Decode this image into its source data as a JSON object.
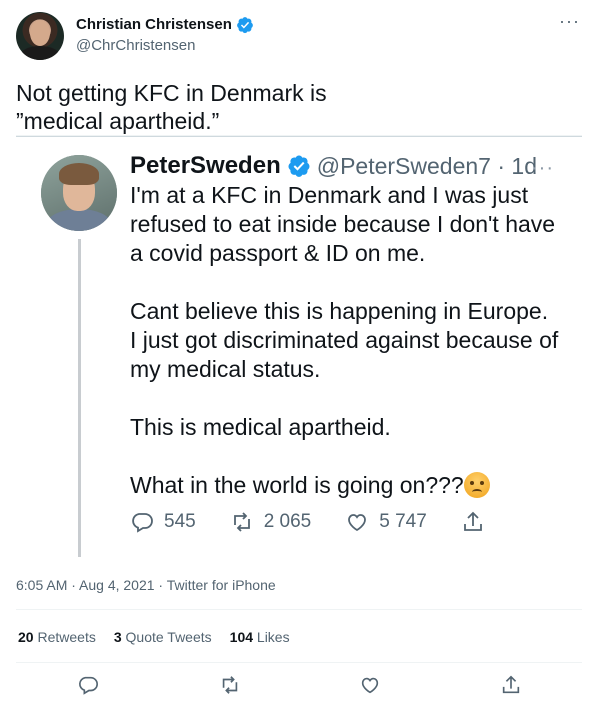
{
  "author": {
    "display_name": "Christian Christensen",
    "handle": "@ChrChristensen",
    "verified_icon": "verified-badge-icon",
    "more_icon": "more-icon"
  },
  "tweet": {
    "text_line1": "Not getting KFC in Denmark is",
    "text_line2": "”medical apartheid.”"
  },
  "quoted": {
    "display_name": "PeterSweden",
    "handle_time": "@PeterSweden7 · 1d",
    "paragraph1": "I'm at a KFC in Denmark and I was just refused to eat inside because I don't have a covid passport & ID on me.",
    "paragraph2": "Cant believe this is happening in Europe. I just got discriminated against because of my medical status.",
    "paragraph3": "This is medical apartheid.",
    "paragraph4": "What in the world is going on???",
    "emoji": "angry-face-emoji",
    "replies": "545",
    "retweets": "2 065",
    "likes": "5 747"
  },
  "meta": {
    "timestamp": "6:05 AM · Aug 4, 2021 · Twitter for iPhone"
  },
  "stats": {
    "retweets_count": "20",
    "retweets_label": "Retweets",
    "quote_count": "3",
    "quote_label": "Quote Tweets",
    "likes_count": "104",
    "likes_label": "Likes"
  },
  "colors": {
    "accent": "#1d9bf0",
    "secondary_text": "#536471",
    "primary_text": "#0f1419"
  }
}
